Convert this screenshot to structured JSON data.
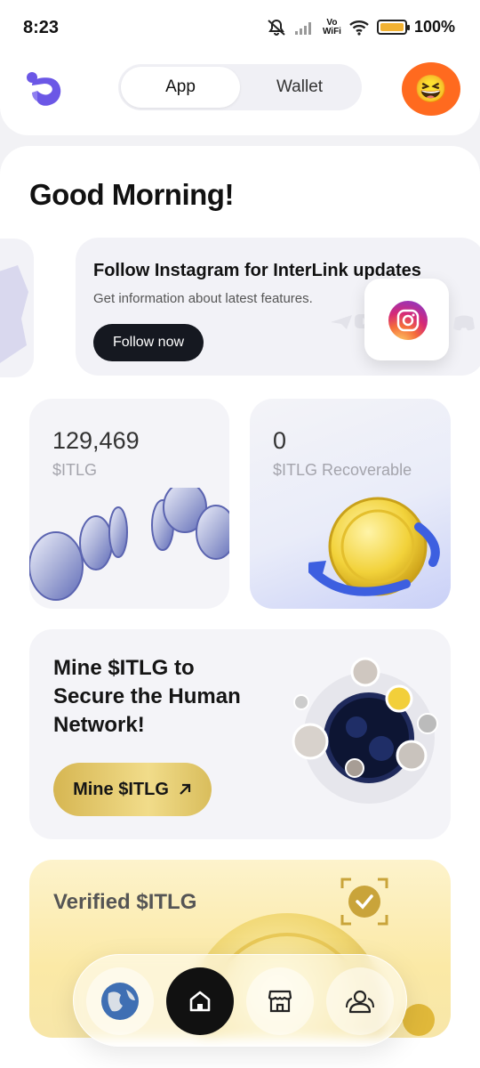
{
  "status_bar": {
    "time": "8:23",
    "network": "Vo\nWiFi",
    "battery": "100%",
    "battery_fill": 1.0,
    "battery_color": "#f2b233"
  },
  "header": {
    "tabs": [
      {
        "label": "App",
        "active": true
      },
      {
        "label": "Wallet",
        "active": false
      }
    ],
    "avatar_emoji": "😆",
    "avatar_color": "#ff6a1f",
    "brand_color": "#6b57e6"
  },
  "greeting": "Good Morning!",
  "banner": {
    "title": "Follow Instagram for InterLink updates",
    "subtitle": "Get information about latest features.",
    "button_label": "Follow now",
    "icons": [
      "telegram-icon",
      "youtube-icon",
      "instagram-icon",
      "discord-icon"
    ]
  },
  "balances": {
    "itlg": {
      "value": "129,469",
      "label": "$ITLG"
    },
    "recoverable": {
      "value": "0",
      "label": "$ITLG Recoverable"
    }
  },
  "mine": {
    "title": "Mine $ITLG to Secure the Human Network!",
    "button_label": "Mine $ITLG"
  },
  "verified": {
    "title": "Verified $ITLG"
  },
  "bottom_nav": {
    "items": [
      "globe-icon",
      "home-icon",
      "store-icon",
      "community-icon"
    ],
    "active": "home-icon"
  }
}
